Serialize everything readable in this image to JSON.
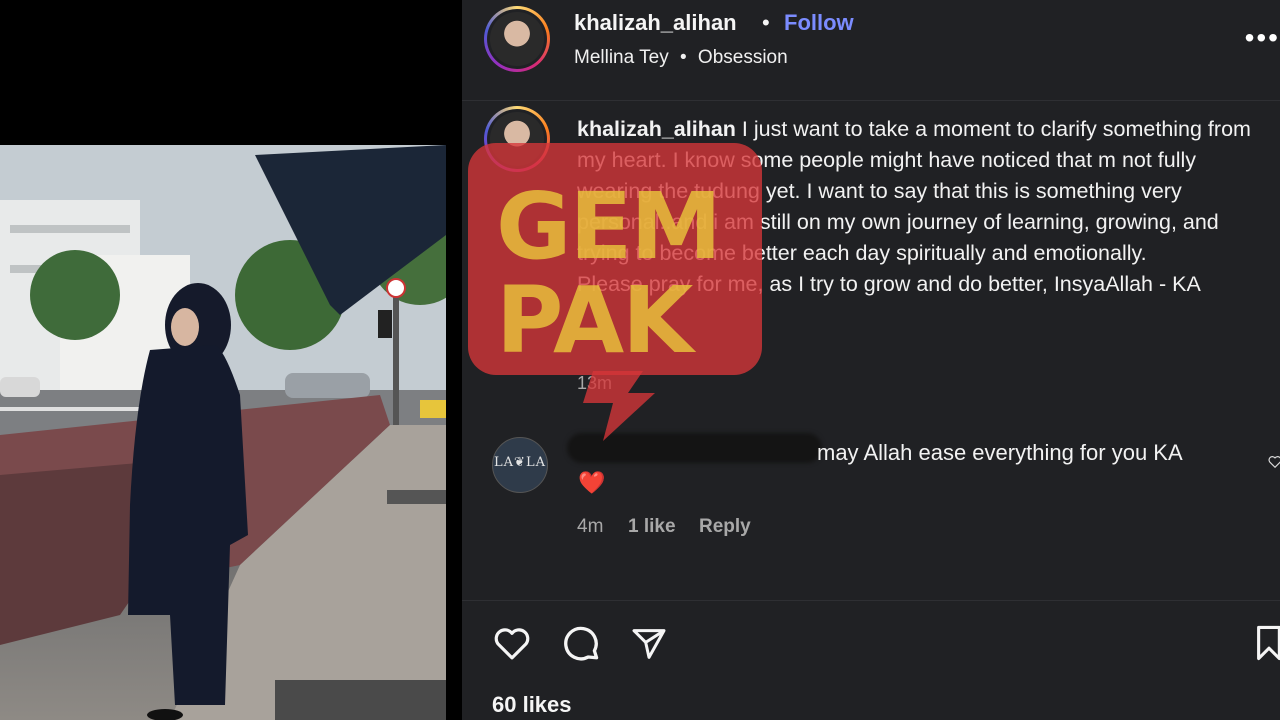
{
  "post": {
    "username": "khalizah_alihan",
    "separator": "•",
    "follow_label": "Follow",
    "audio_artist": "Mellina Tey",
    "audio_track": "Obsession",
    "more_label": "•••"
  },
  "caption": {
    "username": "khalizah_alihan",
    "line1": " I just want to take a moment to clarify something from my heart. I know some people might have noticed that m not fully wearing the tudung yet. I want to say that this is something very personal..and i am still on my own journey of learning, growing, and trying to become better each day spiritually and emotionally.",
    "line2": "Please pray for me, as I try to grow and do better, InsyaAllah - KA",
    "time": "13m"
  },
  "comment": {
    "avatar_label": "LA❦LA",
    "text": "may Allah ease everything for you KA",
    "emoji": "❤️",
    "time": "4m",
    "likes": "1 like",
    "reply_label": "Reply"
  },
  "footer": {
    "likes": "60 likes"
  },
  "watermark": {
    "line1": "GEM",
    "line2": "PAK"
  },
  "colors": {
    "follow": "#7b8cff",
    "pane_bg": "#202124",
    "watermark_red": "#d63638"
  }
}
